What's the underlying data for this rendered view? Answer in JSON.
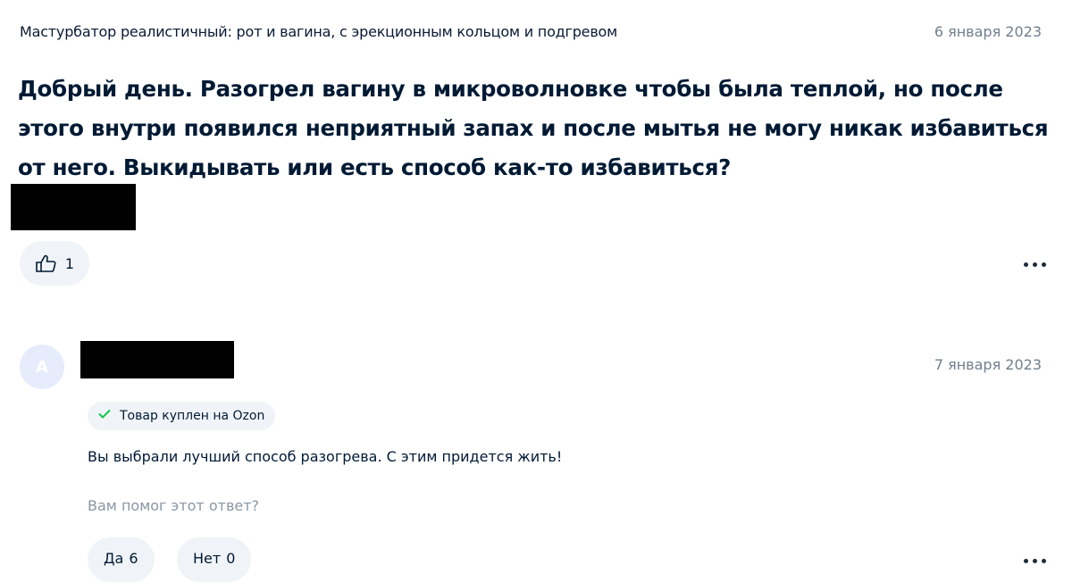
{
  "question": {
    "product_title": "Мастурбатор реалистичный: рот и вагина, с эрекционным кольцом и подгревом",
    "date": "6 января 2023",
    "text": "Добрый день. Разогрел вагину в микроволновке чтобы была теплой, но после этого внутри появился неприятный запах и после мытья не могу никак избавиться от него. Выкидывать или есть способ как-то избавиться?",
    "like_count": "1"
  },
  "answer": {
    "avatar_letter": "А",
    "date": "7 января 2023",
    "badge_text": "Товар куплен на Ozon",
    "text": "Вы выбрали лучший способ разогрева. С этим придется жить!",
    "helpful_prompt": "Вам помог этот ответ?",
    "yes_label": "Да",
    "yes_count": "6",
    "no_label": "Нет",
    "no_count": "0"
  },
  "colors": {
    "accent_green": "#10c44c",
    "muted_text": "#707f8d",
    "chip_bg": "#f0f4f8"
  }
}
